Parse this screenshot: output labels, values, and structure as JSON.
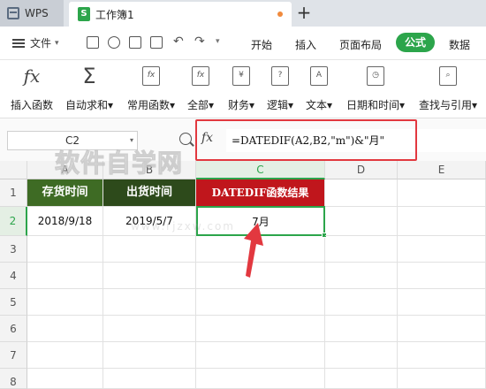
{
  "titlebar": {
    "app_tab": "WPS",
    "doc_tab": "工作簿1",
    "doc_icon": "S",
    "new_tab": "+"
  },
  "menubar": {
    "file": "文件",
    "items": [
      "开始",
      "插入",
      "页面布局",
      "公式",
      "数据"
    ],
    "active_index": 3
  },
  "ribbon": {
    "items": [
      {
        "label": "插入函数",
        "icon": "fx-icon"
      },
      {
        "label": "自动求和",
        "icon": "sigma-icon",
        "dropdown": true
      },
      {
        "label": "常用函数",
        "icon": "common-functions-icon",
        "dropdown": true
      },
      {
        "label": "全部",
        "icon": "all-functions-icon",
        "dropdown": true
      },
      {
        "label": "财务",
        "icon": "finance-icon",
        "dropdown": true
      },
      {
        "label": "逻辑",
        "icon": "logic-icon",
        "dropdown": true
      },
      {
        "label": "文本",
        "icon": "text-icon",
        "dropdown": true
      },
      {
        "label": "日期和时间",
        "icon": "date-time-icon",
        "dropdown": true
      },
      {
        "label": "查找与引用",
        "icon": "lookup-icon",
        "dropdown": true
      }
    ]
  },
  "formula_bar": {
    "name_box": "C2",
    "fx": "fx",
    "formula": "=DATEDIF(A2,B2,\"m\")&\"月\""
  },
  "grid": {
    "columns": [
      "A",
      "B",
      "C",
      "D",
      "E"
    ],
    "rows": [
      "1",
      "2",
      "3",
      "4",
      "5",
      "6",
      "7",
      "8"
    ],
    "headers": [
      "存货时间",
      "出货时间",
      "DATEDIF函数结果"
    ],
    "row2": [
      "2018/9/18",
      "2019/5/7",
      "7月"
    ],
    "selected_cell": "C2"
  },
  "watermark": {
    "text": "软件自学网",
    "url": "www.rjzxw.com"
  },
  "colors": {
    "accent": "#2ca54b",
    "header_a": "#3e6b24",
    "header_b": "#2d4a1b",
    "header_c": "#c0161c",
    "annotation": "#e2383f"
  }
}
